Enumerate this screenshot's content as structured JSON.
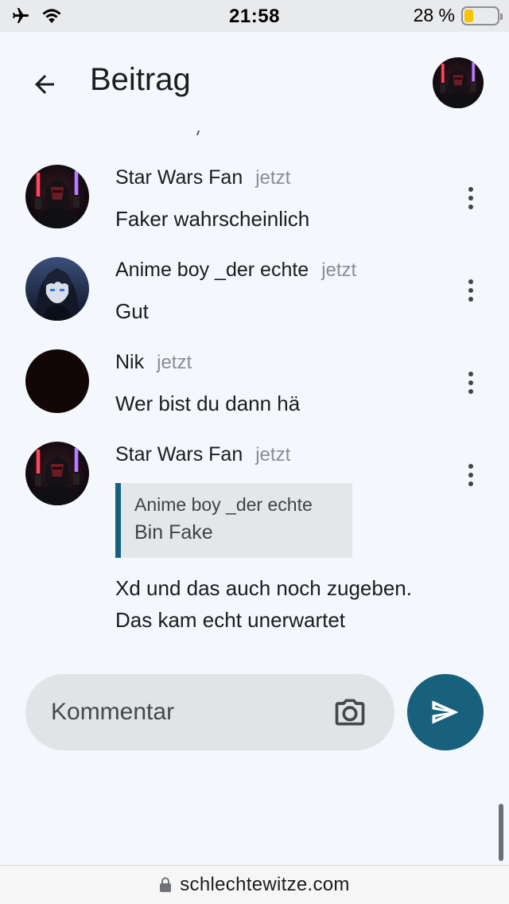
{
  "status_bar": {
    "time": "21:58",
    "battery_text": "28 %",
    "battery_level": 0.28,
    "battery_color": "#f5c400"
  },
  "header": {
    "title": "Beitrag",
    "back_icon": "arrow-left-icon",
    "avatar": "user-avatar"
  },
  "comments": [
    {
      "author": "Star Wars Fan",
      "time": "jetzt",
      "text": "Faker wahrscheinlich",
      "avatar": "dark-lord-avatar"
    },
    {
      "author": "Anime boy _der echte",
      "time": "jetzt",
      "text": "Gut",
      "avatar": "anime-avatar"
    },
    {
      "author": "Nik",
      "time": "jetzt",
      "text": "Wer bist du dann hä",
      "avatar": "dark-avatar"
    },
    {
      "author": "Star Wars Fan",
      "time": "jetzt",
      "avatar": "dark-lord-avatar",
      "quote": {
        "author": "Anime boy _der echte",
        "text": "Bin Fake"
      },
      "text_line1": "Xd und das auch noch zugeben.",
      "text_line2": "Das kam echt unerwartet"
    }
  ],
  "composer": {
    "placeholder": "Kommentar",
    "camera_icon": "camera-icon",
    "send_icon": "send-icon"
  },
  "browser": {
    "url": "schlechtewitze.com",
    "lock_icon": "lock-icon"
  },
  "colors": {
    "accent": "#17617d",
    "background": "#f4f7fc",
    "input_bg": "#e1e3e6",
    "quote_bg": "#e4e7ea"
  }
}
